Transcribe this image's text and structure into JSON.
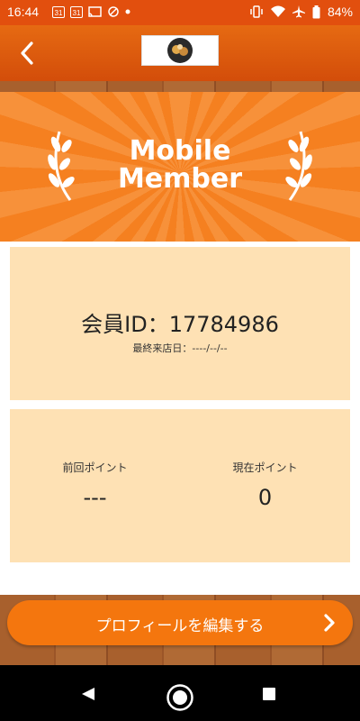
{
  "status_bar": {
    "time": "16:44",
    "calendar_1": "31",
    "calendar_2": "31",
    "battery": "84%"
  },
  "header": {
    "back_icon": "chevron-left-icon",
    "logo": "shop-logo"
  },
  "banner": {
    "title_line1": "Mobile",
    "title_line2": "Member"
  },
  "member_card": {
    "member_id": "会員ID：17784986",
    "last_visit": "最終来店日：----/--/--"
  },
  "points_card": {
    "previous_label": "前回ポイント",
    "previous_value": "---",
    "current_label": "現在ポイント",
    "current_value": "0"
  },
  "edit_profile_button": {
    "label": "プロフィールを編集する",
    "icon": "chevron-right-icon"
  },
  "colors": {
    "header": "#E24F0E",
    "banner": "#F58020",
    "card": "#FEE1B4",
    "button": "#F4760E"
  }
}
